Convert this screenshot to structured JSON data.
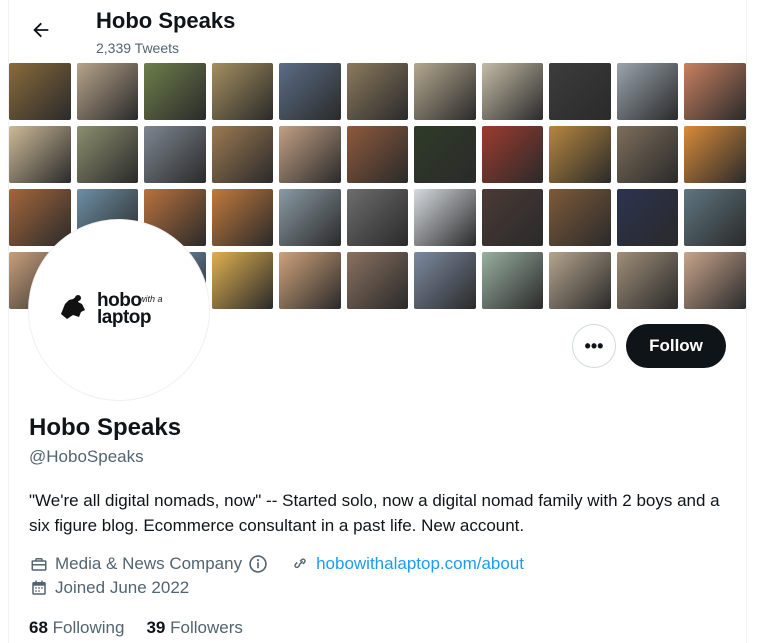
{
  "header": {
    "title": "Hobo Speaks",
    "tweet_count": "2,339 Tweets",
    "back_icon": "arrow-left-icon"
  },
  "banner": {
    "tiles": [
      "#8a6a3c",
      "#b7a48a",
      "#6d7f4a",
      "#a58f5f",
      "#5b6d86",
      "#8c7a5e",
      "#b4a88f",
      "#c5bca6",
      "#3c3c3c",
      "#9aa3ad",
      "#c98060",
      "#cdbb98",
      "#8c8f6e",
      "#7d8791",
      "#9c7a52",
      "#c2a084",
      "#8e5a3c",
      "#2f3b28",
      "#9c3b2e",
      "#b5873f",
      "#7d6e5a",
      "#d98b3a",
      "#a4663c",
      "#6d8fa6",
      "#b9723e",
      "#c27a3c",
      "#8a9aa4",
      "#6d6d6d",
      "#d6dbe0",
      "#4a3a36",
      "#7e5a3a",
      "#2b3350",
      "#5f7680",
      "#c8a07c",
      "#8f8f86",
      "#7aa0c8",
      "#e0b050",
      "#cfa27c",
      "#8a7160",
      "#7c8aa0",
      "#98b0a0",
      "#b5a58e",
      "#a08e78",
      "#c8a58c"
    ]
  },
  "profile": {
    "logo_text_line1": "hobo",
    "logo_text_line2": "laptop",
    "logo_text_small": "with a",
    "name": "Hobo Speaks",
    "handle": "@HoboSpeaks",
    "bio": "\"We're all digital nomads, now\" -- Started solo, now a digital nomad family with 2 boys and a six figure blog. Ecommerce consultant in a past life. New account.",
    "category": "Media & News Company",
    "category_icon": "briefcase-icon",
    "info_icon": "info-icon",
    "link_icon": "link-icon",
    "website": "hobowithalaptop.com/about",
    "calendar_icon": "calendar-icon",
    "joined": "Joined June 2022",
    "following_count": "68",
    "following_label": "Following",
    "followers_count": "39",
    "followers_label": "Followers"
  },
  "actions": {
    "more_label": "•••",
    "follow_label": "Follow"
  },
  "colors": {
    "accent": "#1d9bf0",
    "follow_bg": "#0f1419",
    "muted": "#536471"
  }
}
